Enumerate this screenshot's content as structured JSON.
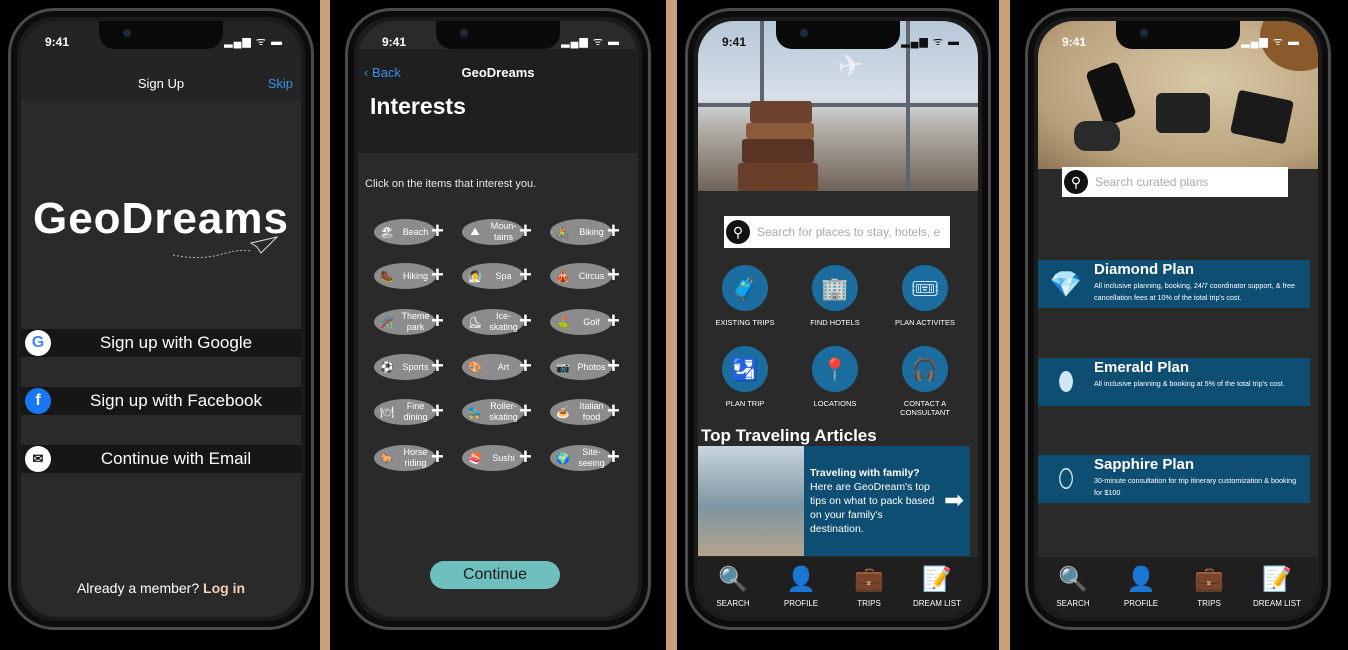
{
  "status": {
    "time": "9:41",
    "icons": "▂▄▆ ᯤ ▬"
  },
  "screen1": {
    "title": "Sign Up",
    "skip": "Skip",
    "logo": "GeoDreams",
    "buttons": [
      {
        "icon": "G",
        "label": "Sign up with Google"
      },
      {
        "icon": "f",
        "label": "Sign up with Facebook"
      },
      {
        "icon": "✉",
        "label": "Continue with Email"
      }
    ],
    "footer_text": "Already a member?",
    "footer_link": "Log in"
  },
  "screen2": {
    "back": "Back",
    "nav_title": "GeoDreams",
    "title": "Interests",
    "subtitle": "Click on the items that interest you.",
    "interests": [
      {
        "icon": "🏖",
        "label": "Beach"
      },
      {
        "icon": "⛰",
        "label": "Moun-tains"
      },
      {
        "icon": "🚴",
        "label": "Biking"
      },
      {
        "icon": "🥾",
        "label": "Hiking"
      },
      {
        "icon": "🧖",
        "label": "Spa"
      },
      {
        "icon": "🎪",
        "label": "Circus"
      },
      {
        "icon": "🎢",
        "label": "Theme park"
      },
      {
        "icon": "⛸",
        "label": "Ice-skating"
      },
      {
        "icon": "⛳",
        "label": "Golf"
      },
      {
        "icon": "⚽",
        "label": "Sports"
      },
      {
        "icon": "🎨",
        "label": "Art"
      },
      {
        "icon": "📷",
        "label": "Photos"
      },
      {
        "icon": "🍽",
        "label": "Fine dining"
      },
      {
        "icon": "🛼",
        "label": "Roller-skating"
      },
      {
        "icon": "🍝",
        "label": "Italian food"
      },
      {
        "icon": "🐎",
        "label": "Horse riding"
      },
      {
        "icon": "🍣",
        "label": "Sushi"
      },
      {
        "icon": "🌍",
        "label": "Site-seeing"
      }
    ],
    "continue": "Continue"
  },
  "screen3": {
    "search_placeholder": "Search for places to stay, hotels, e",
    "features": [
      {
        "icon": "🧳",
        "label": "EXISTING TRIPS"
      },
      {
        "icon": "🏢",
        "label": "FIND HOTELS"
      },
      {
        "icon": "🎟",
        "label": "PLAN ACTIVITES"
      },
      {
        "icon": "🛂",
        "label": "PLAN TRIP"
      },
      {
        "icon": "📍",
        "label": "LOCATIONS"
      },
      {
        "icon": "🎧",
        "label": "CONTACT A CONSULTANT"
      }
    ],
    "articles_heading": "Top Traveling Articles",
    "article_title": "Traveling with family?",
    "article_body": "Here are GeoDream's top tips on what to pack based on your family's destination.",
    "article_arrow": "➡"
  },
  "screen4": {
    "search_placeholder": "Search curated plans",
    "plans": [
      {
        "icon": "💎",
        "name": "Diamond Plan",
        "desc": "All inclusive planning, booking, 24/7 coordinator support, & free cancellation fees at 10% of the total trip's cost."
      },
      {
        "icon": "⬮",
        "name": "Emerald Plan",
        "desc": "All inclusive planning & booking at 5% of the total trip's cost."
      },
      {
        "icon": "⬯",
        "name": "Sapphire Plan",
        "desc": "30-minute consultation for trip itinerary customization & booking for $100"
      }
    ]
  },
  "tabbar": [
    {
      "icon": "🔍",
      "label": "SEARCH"
    },
    {
      "icon": "👤",
      "label": "PROFILE"
    },
    {
      "icon": "💼",
      "label": "TRIPS"
    },
    {
      "icon": "📝",
      "label": "DREAM LIST"
    }
  ],
  "colors": {
    "accent_blue": "#3a8fe8",
    "card_blue": "#0f4e73",
    "icon_blue": "#1c6d9f",
    "continue_teal": "#6fbfbe",
    "login_peach": "#f3d3b8"
  }
}
